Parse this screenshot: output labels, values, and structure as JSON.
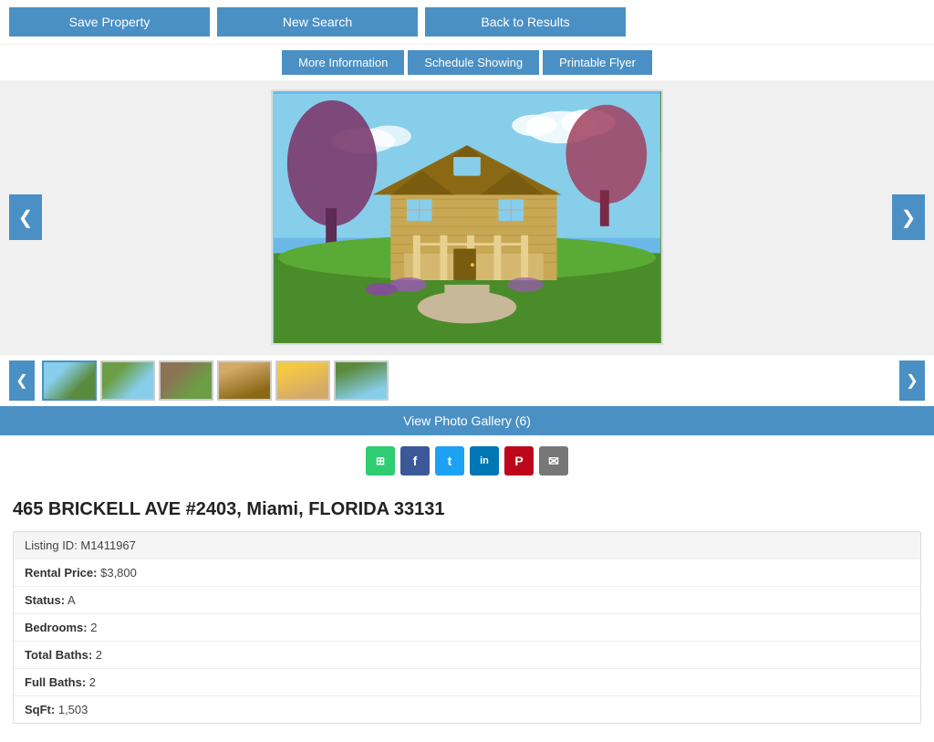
{
  "topBar": {
    "saveProperty": "Save Property",
    "newSearch": "New Search",
    "backToResults": "Back to Results"
  },
  "secondaryBar": {
    "moreInfo": "More Information",
    "scheduleShowing": "Schedule Showing",
    "printableFlyer": "Printable Flyer"
  },
  "imageNav": {
    "prevArrow": "❮",
    "nextArrow": "❯"
  },
  "thumbnailNav": {
    "prevArrow": "❮",
    "nextArrow": "❯",
    "count": 6
  },
  "galleryBar": {
    "label": "View Photo Gallery (6)"
  },
  "social": {
    "share": "⊞",
    "facebook": "f",
    "twitter": "t",
    "linkedin": "in",
    "pinterest": "P",
    "email": "✉"
  },
  "property": {
    "address": "465 BRICKELL AVE #2403, Miami, FLORIDA 33131",
    "listingId": "Listing ID: M1411967",
    "rentalPriceLabel": "Rental Price:",
    "rentalPrice": "$3,800",
    "statusLabel": "Status:",
    "status": "A",
    "bedroomsLabel": "Bedrooms:",
    "bedrooms": "2",
    "totalBathsLabel": "Total Baths:",
    "totalBaths": "2",
    "fullBathsLabel": "Full Baths:",
    "fullBaths": "2",
    "sqftLabel": "SqFt:",
    "sqft": "1,503"
  }
}
